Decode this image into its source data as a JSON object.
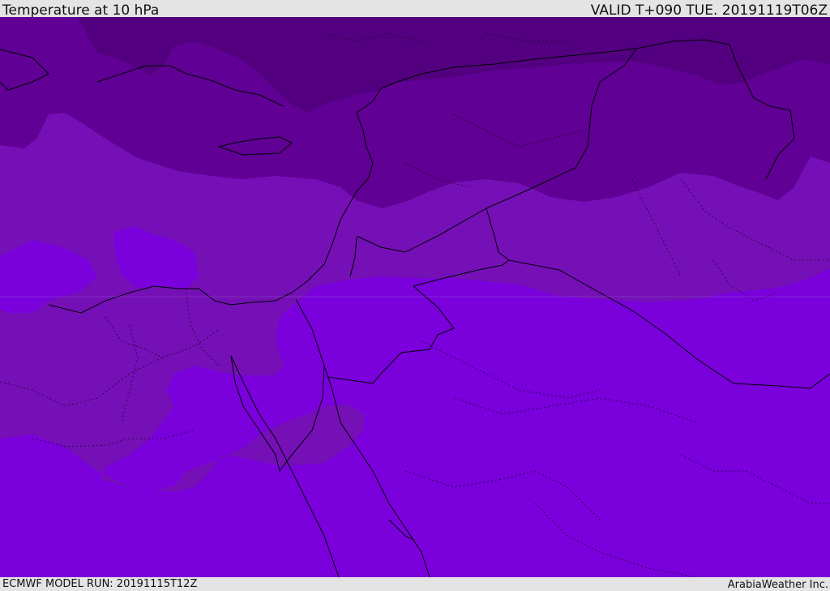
{
  "header": {
    "title": "Temperature at 10 hPa",
    "valid": "VALID T+090 TUE. 20191119T06Z"
  },
  "footer": {
    "model_run": "ECMWF MODEL RUN: 20191115T12Z",
    "credit": "ArabiaWeather Inc."
  },
  "colors": {
    "band_darkest": "#520080",
    "band_dark": "#600094",
    "band_mid": "#7410b6",
    "band_bright": "#7a00dc",
    "borders": "#000000"
  }
}
